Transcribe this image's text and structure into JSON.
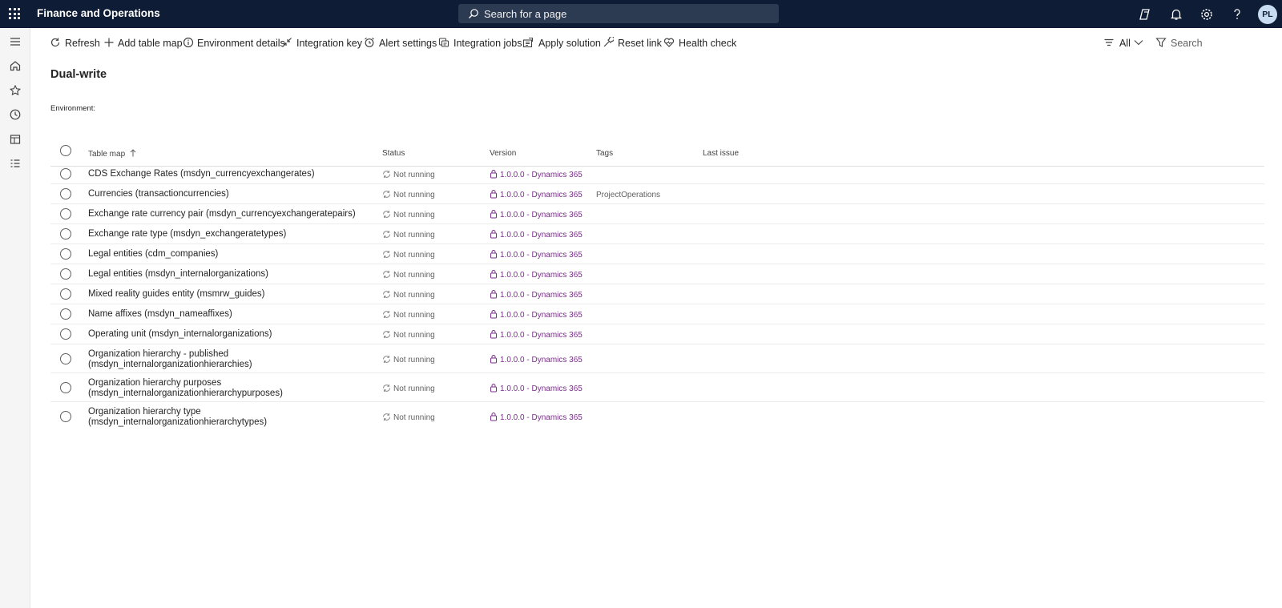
{
  "app": {
    "title": "Finance and Operations"
  },
  "search": {
    "placeholder": "Search for a page"
  },
  "user": {
    "initials": "PL"
  },
  "toolbar": {
    "refresh": "Refresh",
    "add_table_map": "Add table map",
    "environment_details": "Environment details",
    "integration_key": "Integration key",
    "alert_settings": "Alert settings",
    "integration_jobs": "Integration jobs",
    "apply_solution": "Apply solution",
    "reset_link": "Reset link",
    "health_check": "Health check",
    "filter_all": "All",
    "search": "Search"
  },
  "page": {
    "title": "Dual-write",
    "environment_label": "Environment:"
  },
  "grid": {
    "columns": {
      "table_map": "Table map",
      "status": "Status",
      "version": "Version",
      "tags": "Tags",
      "last_issue": "Last issue"
    },
    "rows": [
      {
        "name1": "CDS Exchange Rates (msdyn_currencyexchangerates)",
        "name2": "",
        "status": "Not running",
        "version": "1.0.0.0 - Dynamics 365",
        "tags": ""
      },
      {
        "name1": "Currencies (transactioncurrencies)",
        "name2": "",
        "status": "Not running",
        "version": "1.0.0.0 - Dynamics 365",
        "tags": "ProjectOperations"
      },
      {
        "name1": "Exchange rate currency pair (msdyn_currencyexchangeratepairs)",
        "name2": "",
        "status": "Not running",
        "version": "1.0.0.0 - Dynamics 365",
        "tags": ""
      },
      {
        "name1": "Exchange rate type (msdyn_exchangeratetypes)",
        "name2": "",
        "status": "Not running",
        "version": "1.0.0.0 - Dynamics 365",
        "tags": ""
      },
      {
        "name1": "Legal entities (cdm_companies)",
        "name2": "",
        "status": "Not running",
        "version": "1.0.0.0 - Dynamics 365",
        "tags": ""
      },
      {
        "name1": "Legal entities (msdyn_internalorganizations)",
        "name2": "",
        "status": "Not running",
        "version": "1.0.0.0 - Dynamics 365",
        "tags": ""
      },
      {
        "name1": "Mixed reality guides entity (msmrw_guides)",
        "name2": "",
        "status": "Not running",
        "version": "1.0.0.0 - Dynamics 365",
        "tags": ""
      },
      {
        "name1": "Name affixes (msdyn_nameaffixes)",
        "name2": "",
        "status": "Not running",
        "version": "1.0.0.0 - Dynamics 365",
        "tags": ""
      },
      {
        "name1": "Operating unit (msdyn_internalorganizations)",
        "name2": "",
        "status": "Not running",
        "version": "1.0.0.0 - Dynamics 365",
        "tags": ""
      },
      {
        "name1": "Organization hierarchy - published",
        "name2": "(msdyn_internalorganizationhierarchies)",
        "status": "Not running",
        "version": "1.0.0.0 - Dynamics 365",
        "tags": ""
      },
      {
        "name1": "Organization hierarchy purposes",
        "name2": "(msdyn_internalorganizationhierarchypurposes)",
        "status": "Not running",
        "version": "1.0.0.0 - Dynamics 365",
        "tags": ""
      },
      {
        "name1": "Organization hierarchy type",
        "name2": "(msdyn_internalorganizationhierarchytypes)",
        "status": "Not running",
        "version": "1.0.0.0 - Dynamics 365",
        "tags": ""
      }
    ]
  },
  "colors": {
    "topbar": "#0f1c35",
    "version_link": "#7a2e8a"
  }
}
